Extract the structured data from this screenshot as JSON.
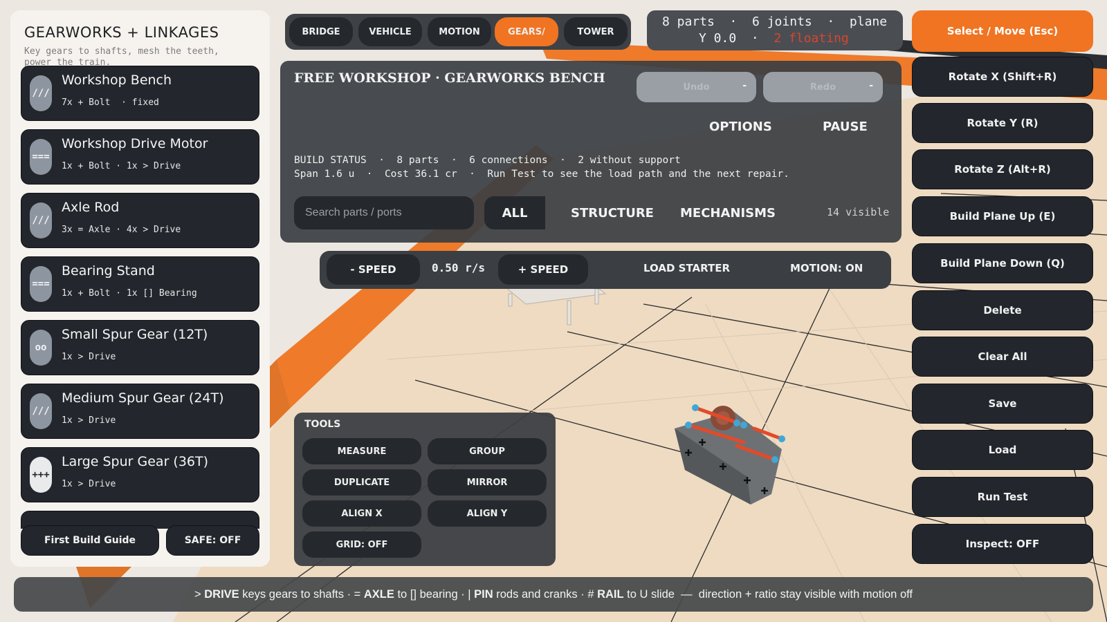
{
  "accent": "#f07421",
  "sidebar": {
    "title": "GEARWORKS + LINKAGES",
    "subtitle": "Key gears to shafts, mesh the teeth, power the train.",
    "parts": [
      {
        "name": "Workshop Bench",
        "meta": "7x + Bolt  · fixed",
        "icon": "///"
      },
      {
        "name": "Workshop Drive Motor",
        "meta": "1x + Bolt · 1x > Drive",
        "icon": "==="
      },
      {
        "name": "Axle Rod",
        "meta": "3x = Axle · 4x > Drive",
        "icon": "///"
      },
      {
        "name": "Bearing Stand",
        "meta": "1x + Bolt · 1x [] Bearing",
        "icon": "==="
      },
      {
        "name": "Small Spur Gear (12T)",
        "meta": "1x > Drive",
        "icon": "oo"
      },
      {
        "name": "Medium Spur Gear (24T)",
        "meta": "1x > Drive",
        "icon": "///"
      },
      {
        "name": "Large Spur Gear (36T)",
        "meta": "1x > Drive",
        "icon": "+++"
      }
    ],
    "first_build_label": "First Build Guide",
    "safe_label": "SAFE: OFF"
  },
  "tabs": [
    {
      "label": "BRIDGE",
      "active": false
    },
    {
      "label": "VEHICLE",
      "active": false
    },
    {
      "label": "MOTION",
      "active": false
    },
    {
      "label": "GEARS/",
      "active": true
    },
    {
      "label": "TOWER",
      "active": false
    }
  ],
  "stats": {
    "line1": "8 parts  ·  6 joints  ·  plane",
    "line2": "Y 0.0  ·  ",
    "floating": "2 floating"
  },
  "select_label": "Select / Move (Esc)",
  "tool_column": [
    "Rotate X (Shift+R)",
    "Rotate Y (R)",
    "Rotate Z (Alt+R)",
    "Build Plane Up (E)",
    "Build Plane Down (Q)",
    "Delete",
    "Clear All",
    "Save",
    "Load",
    "Run Test",
    "Inspect: OFF"
  ],
  "main": {
    "title": "FREE WORKSHOP · GEARWORKS BENCH",
    "undo_label": "Undo",
    "redo_label": "Redo",
    "undo_dash": "-",
    "redo_dash": "-",
    "options_label": "OPTIONS",
    "pause_label": "PAUSE",
    "status_line1": "BUILD STATUS  ·  8 parts  ·  6 connections  ·  2 without support",
    "status_line2": "Span 1.6 u  ·  Cost 36.1 cr  ·  Run Test to see the load path and the next repair.",
    "search_placeholder": "Search parts / ports",
    "filters": [
      "ALL",
      "STRUCTURE",
      "MECHANISMS"
    ],
    "visible_count": "14 visible"
  },
  "speed_bar": {
    "minus_label": "- SPEED",
    "value": "0.50 r/s",
    "plus_label": "+ SPEED",
    "load_label": "LOAD STARTER",
    "motion_label": "MOTION: ON"
  },
  "tools": {
    "title": "TOOLS",
    "buttons": [
      "MEASURE",
      "GROUP",
      "DUPLICATE",
      "MIRROR",
      "ALIGN X",
      "ALIGN Y",
      "GRID: OFF"
    ]
  },
  "hint": {
    "p1": "> ",
    "b1": "DRIVE",
    "p2": " keys gears to shafts · = ",
    "b2": "AXLE",
    "p3": " to [] bearing · | ",
    "b3": "PIN",
    "p4": " rods and cranks · # ",
    "b4": "RAIL",
    "p5": " to U slide  —  direction + ratio stay visible with motion off"
  }
}
